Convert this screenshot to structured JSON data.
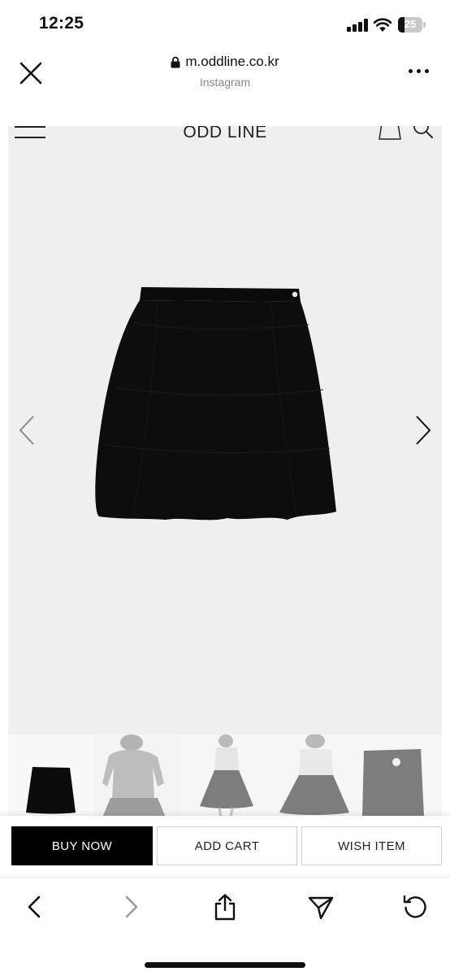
{
  "status_bar": {
    "time": "12:25",
    "battery_level": "25"
  },
  "browser": {
    "url": "m.oddline.co.kr",
    "subtitle": "Instagram"
  },
  "site": {
    "brand": "ODD LINE"
  },
  "actions": {
    "buy_now": "BUY NOW",
    "add_cart": "ADD CART",
    "wish_item": "WISH ITEM"
  },
  "colors": {
    "page_bg": "#ffffff",
    "site_bg": "#efefef",
    "primary_button": "#000000"
  },
  "icons": [
    "close-icon",
    "lock-icon",
    "more-icon",
    "menu-icon",
    "bag-icon",
    "search-icon",
    "chevron-left-icon",
    "chevron-right-icon",
    "back-icon",
    "forward-icon",
    "share-icon",
    "send-icon",
    "reload-icon"
  ]
}
